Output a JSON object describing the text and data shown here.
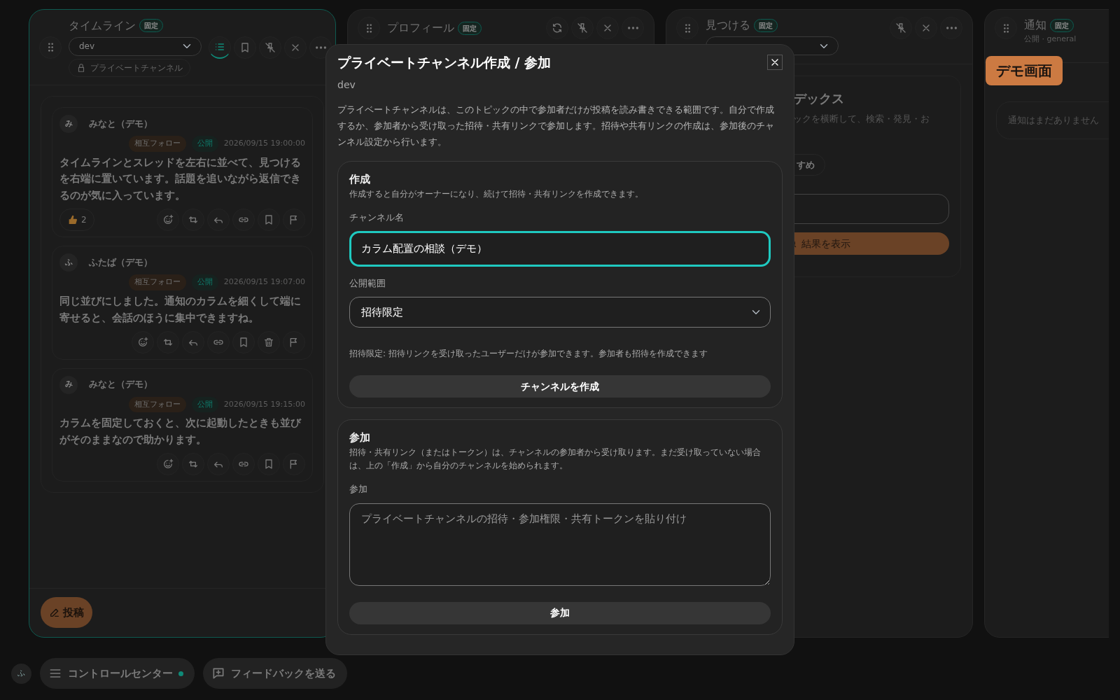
{
  "columns": [
    {
      "kind": "timeline",
      "title": "タイムライン",
      "badge": "固定",
      "focused": true,
      "channel": "dev",
      "chip": "プライベートチャンネル",
      "tools": [
        {
          "kind": "list",
          "selected": true
        },
        {
          "kind": "bookmark",
          "selected": false
        },
        {
          "kind": "unpin",
          "selected": false
        },
        {
          "kind": "close",
          "selected": false
        },
        {
          "kind": "more",
          "selected": false
        }
      ],
      "posts": [
        {
          "avatar": "み",
          "author": "みなと（デモ）",
          "relation": "相互フォロー",
          "visibility": "公開",
          "time": "2026/09/15 19:00:00",
          "body": "タイムラインとスレッドを左右に並べて、見つけるを右端に置いています。話題を追いながら返信できるのが気に入っています。",
          "reaction_count": "2",
          "actions": [
            {
              "kind": "react"
            },
            {
              "kind": "repost"
            },
            {
              "kind": "reply"
            },
            {
              "kind": "link"
            },
            {
              "kind": "bookmark"
            },
            {
              "kind": "flag"
            }
          ]
        },
        {
          "avatar": "ふ",
          "author": "ふたば（デモ）",
          "relation": "相互フォロー",
          "visibility": "公開",
          "time": "2026/09/15 19:07:00",
          "body": "同じ並びにしました。通知のカラムを細くして端に寄せると、会話のほうに集中できますね。",
          "actions": [
            {
              "kind": "react"
            },
            {
              "kind": "repost"
            },
            {
              "kind": "reply"
            },
            {
              "kind": "link"
            },
            {
              "kind": "bookmark"
            },
            {
              "kind": "trash"
            },
            {
              "kind": "flag"
            }
          ]
        },
        {
          "avatar": "み",
          "author": "みなと（デモ）",
          "relation": "相互フォロー",
          "visibility": "公開",
          "time": "2026/09/15 19:15:00",
          "body": "カラムを固定しておくと、次に起動したときも並びがそのままなので助かります。",
          "actions": [
            {
              "kind": "react"
            },
            {
              "kind": "repost"
            },
            {
              "kind": "reply"
            },
            {
              "kind": "link"
            },
            {
              "kind": "bookmark"
            },
            {
              "kind": "flag"
            }
          ]
        }
      ],
      "compose": "投稿"
    },
    {
      "kind": "profile",
      "title": "プロフィール",
      "badge": "固定",
      "focused": false,
      "tools": [
        {
          "kind": "refresh",
          "selected": false
        },
        {
          "kind": "unpin",
          "selected": false
        },
        {
          "kind": "close",
          "selected": false
        },
        {
          "kind": "more",
          "selected": false
        }
      ]
    },
    {
      "kind": "find",
      "title": "見つける",
      "badge": "固定",
      "focused": false,
      "tools": [
        {
          "kind": "unpin",
          "selected": false
        },
        {
          "kind": "close",
          "selected": false
        },
        {
          "kind": "more",
          "selected": false
        }
      ],
      "heading": "デックス",
      "text": "ックを横断して、検索・発見・お",
      "chip": "すめ",
      "button": "結果を表示"
    },
    {
      "kind": "notifications",
      "title": "通知",
      "badge": "固定",
      "focused": false,
      "subtitle": "公開 · general",
      "empty": "通知はまだありません"
    }
  ],
  "dialog": {
    "title": "プライベートチャンネル作成 / 参加",
    "subtitle": "dev",
    "description": "プライベートチャンネルは、このトピックの中で参加者だけが投稿を読み書きできる範囲です。自分で作成するか、参加者から受け取った招待・共有リンクで参加します。招待や共有リンクの作成は、参加後のチャンネル設定から行います。",
    "sections": [
      {
        "title": "作成",
        "description": "作成すると自分がオーナーになり、続けて招待・共有リンクを作成できます。",
        "fields": [
          {
            "kind": "text",
            "label": "チャンネル名",
            "value": "カラム配置の相談（デモ）",
            "focused": true
          },
          {
            "kind": "select",
            "label": "公開範囲",
            "value": "招待限定",
            "help": "招待限定: 招待リンクを受け取ったユーザーだけが参加できます。参加者も招待を作成できます"
          }
        ],
        "button": "チャンネルを作成"
      },
      {
        "title": "参加",
        "description": "招待・共有リンク（またはトークン）は、チャンネルの参加者から受け取ります。まだ受け取っていない場合は、上の「作成」から自分のチャンネルを始められます。",
        "fields": [
          {
            "kind": "textarea",
            "label": "参加",
            "placeholder": "プライベートチャンネルの招待・参加権限・共有トークンを貼り付け"
          }
        ],
        "button": "参加"
      }
    ]
  },
  "bottom_bar": {
    "avatar": "ふ",
    "control_center": "コントロールセンター",
    "connected": true,
    "feedback": "フィードバックを送る"
  },
  "demo_label": "デモ画面"
}
